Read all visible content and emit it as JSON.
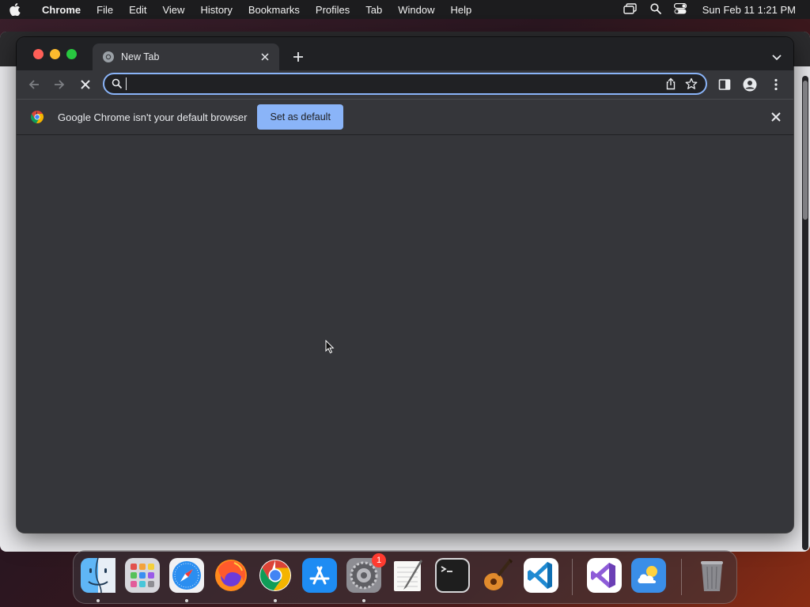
{
  "menubar": {
    "app_name": "Chrome",
    "items": [
      "File",
      "Edit",
      "View",
      "History",
      "Bookmarks",
      "Profiles",
      "Tab",
      "Window",
      "Help"
    ],
    "clock": "Sun Feb 11  1:21 PM"
  },
  "chrome": {
    "tab": {
      "title": "New Tab"
    },
    "omnibox": {
      "value": ""
    },
    "infobar": {
      "message": "Google Chrome isn't your default browser",
      "button_label": "Set as default"
    }
  },
  "dock": {
    "items": [
      "Finder",
      "Launchpad",
      "Safari",
      "Firefox",
      "Google Chrome",
      "App Store",
      "System Preferences",
      "TextEdit",
      "Terminal",
      "GarageBand",
      "Visual Studio Code",
      "Visual Studio",
      "Weather",
      "Trash"
    ],
    "system_preferences_badge": "1"
  }
}
